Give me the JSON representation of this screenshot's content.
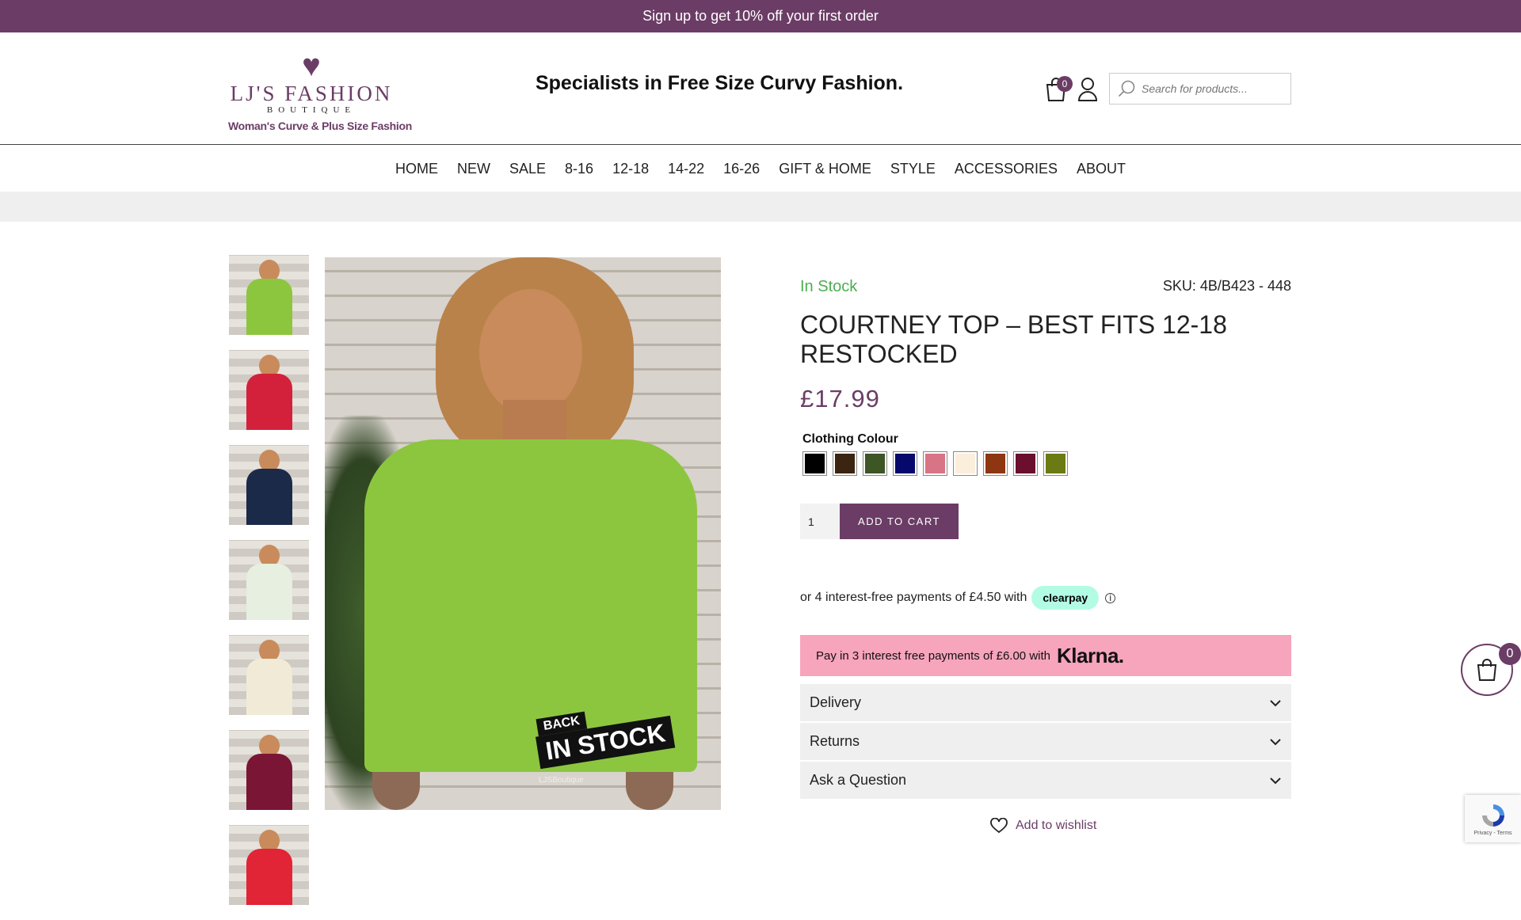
{
  "announcement": "Sign up to get 10% off your first order",
  "logo": {
    "brand": "LJ'S FASHION",
    "subbrand": "BOUTIQUE",
    "tagline": "Woman's Curve & Plus Size Fashion"
  },
  "header": {
    "slogan": "Specialists in Free Size Curvy Fashion.",
    "cart_count": "0",
    "search_placeholder": "Search for products..."
  },
  "nav": [
    "HOME",
    "NEW",
    "SALE",
    "8-16",
    "12-18",
    "14-22",
    "16-26",
    "GIFT & HOME",
    "STYLE",
    "ACCESSORIES",
    "ABOUT"
  ],
  "thumbnails": [
    {
      "top_color": "#8cc63f"
    },
    {
      "top_color": "#d4213b"
    },
    {
      "top_color": "#1c2a4a"
    },
    {
      "top_color": "#e6efe0"
    },
    {
      "top_color": "#f1ead6"
    },
    {
      "top_color": "#7a1535"
    },
    {
      "top_color": "#e12436"
    }
  ],
  "main_image": {
    "badge_back": "BACK",
    "badge_instock": "IN STOCK",
    "watermark": "LJSBoutique"
  },
  "product": {
    "stock_status": "In Stock",
    "sku": "SKU: 4B/B423 - 448",
    "title": "COURTNEY TOP – BEST FITS 12-18 RESTOCKED",
    "price": "£17.99",
    "colour_label": "Clothing Colour",
    "swatches": [
      "#000000",
      "#3b2410",
      "#3e5525",
      "#06096b",
      "#d97386",
      "#fbeedb",
      "#8e3511",
      "#6a0f2e",
      "#6b7a12"
    ],
    "quantity": "1",
    "add_to_cart": "ADD TO CART"
  },
  "clearpay": {
    "text": "or 4 interest-free payments of £4.50 with",
    "brand": "clearpay",
    "info": "i"
  },
  "klarna": {
    "text": "Pay in 3 interest free payments of £6.00 with",
    "brand": "Klarna."
  },
  "accordion": [
    "Delivery",
    "Returns",
    "Ask a Question"
  ],
  "wishlist_label": "Add to wishlist",
  "floating_cart_count": "0",
  "recaptcha_text": "Privacy - Terms",
  "colors": {
    "brand_purple": "#6b3d66",
    "in_stock_green": "#4caf50",
    "klarna_pink": "#f7a4bd",
    "clearpay_mint": "#b2fce4"
  }
}
